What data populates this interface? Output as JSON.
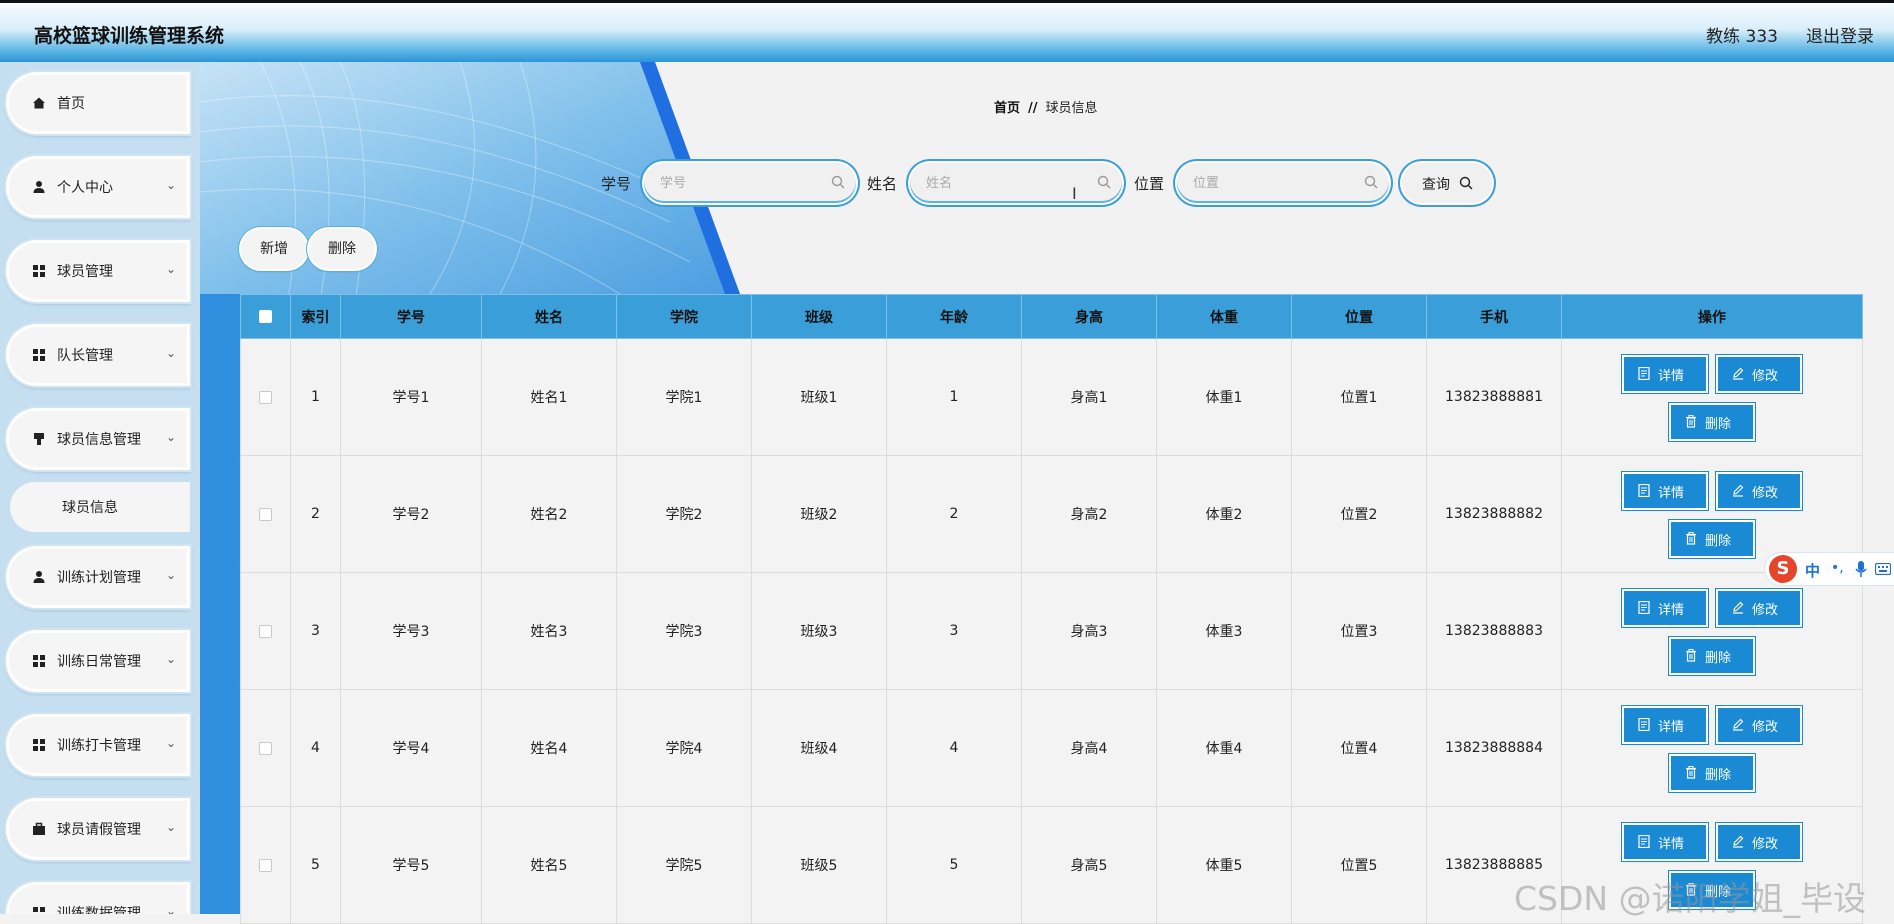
{
  "header": {
    "title": "高校篮球训练管理系统",
    "user": "教练 333",
    "logout": "退出登录"
  },
  "sidebar": {
    "items": [
      {
        "label": "首页",
        "icon": "home-icon",
        "chevron": false
      },
      {
        "label": "个人中心",
        "icon": "user-icon",
        "chevron": true
      },
      {
        "label": "球员管理",
        "icon": "grid-icon",
        "chevron": true
      },
      {
        "label": "队长管理",
        "icon": "grid-icon",
        "chevron": true
      },
      {
        "label": "球员信息管理",
        "icon": "flag-icon",
        "chevron": true
      },
      {
        "label": "训练计划管理",
        "icon": "user-icon",
        "chevron": true
      },
      {
        "label": "训练日常管理",
        "icon": "grid-icon",
        "chevron": true
      },
      {
        "label": "训练打卡管理",
        "icon": "grid-icon",
        "chevron": true
      },
      {
        "label": "球员请假管理",
        "icon": "briefcase-icon",
        "chevron": true
      },
      {
        "label": "训练数据管理",
        "icon": "grid-icon",
        "chevron": true
      }
    ],
    "subitem": "球员信息"
  },
  "breadcrumb": {
    "home": "首页",
    "separator": "//",
    "current": "球员信息"
  },
  "search": {
    "fields": [
      {
        "label": "学号",
        "placeholder": "学号"
      },
      {
        "label": "姓名",
        "placeholder": "姓名"
      },
      {
        "label": "位置",
        "placeholder": "位置"
      }
    ],
    "query_label": "查询"
  },
  "actions": {
    "add": "新增",
    "delete": "删除"
  },
  "table": {
    "columns": [
      "索引",
      "学号",
      "姓名",
      "学院",
      "班级",
      "年龄",
      "身高",
      "体重",
      "位置",
      "手机",
      "操作"
    ],
    "rows": [
      {
        "index": "1",
        "id": "学号1",
        "name": "姓名1",
        "college": "学院1",
        "class": "班级1",
        "age": "1",
        "height": "身高1",
        "weight": "体重1",
        "position": "位置1",
        "phone": "13823888881"
      },
      {
        "index": "2",
        "id": "学号2",
        "name": "姓名2",
        "college": "学院2",
        "class": "班级2",
        "age": "2",
        "height": "身高2",
        "weight": "体重2",
        "position": "位置2",
        "phone": "13823888882"
      },
      {
        "index": "3",
        "id": "学号3",
        "name": "姓名3",
        "college": "学院3",
        "class": "班级3",
        "age": "3",
        "height": "身高3",
        "weight": "体重3",
        "position": "位置3",
        "phone": "13823888883"
      },
      {
        "index": "4",
        "id": "学号4",
        "name": "姓名4",
        "college": "学院4",
        "class": "班级4",
        "age": "4",
        "height": "身高4",
        "weight": "体重4",
        "position": "位置4",
        "phone": "13823888884"
      },
      {
        "index": "5",
        "id": "学号5",
        "name": "姓名5",
        "college": "学院5",
        "class": "班级5",
        "age": "5",
        "height": "身高5",
        "weight": "体重5",
        "position": "位置5",
        "phone": "13823888885"
      }
    ],
    "op_detail": "详情",
    "op_edit": "修改",
    "op_delete": "删除"
  },
  "ime": {
    "lang": "中",
    "punct": "•,"
  },
  "watermark": "CSDN @诺阳学姐_毕设",
  "colors": {
    "accent": "#3a9fd8",
    "button": "#1a8ad4",
    "sidebar": "#c5dff0"
  }
}
